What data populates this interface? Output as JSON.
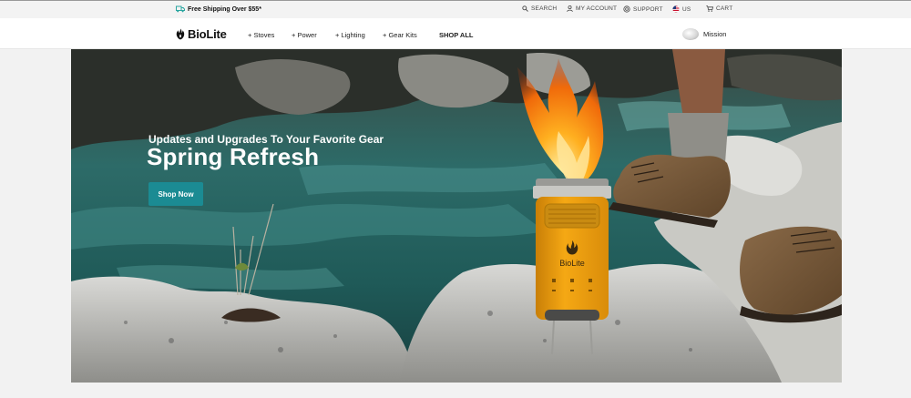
{
  "topbar": {
    "promo": "Free Shipping Over $55*",
    "search": "SEARCH",
    "account": "MY ACCOUNT",
    "support": "SUPPORT",
    "region": "US",
    "cart": "CART"
  },
  "nav": {
    "brand": "BioLite",
    "items": [
      {
        "label": "+ Stoves"
      },
      {
        "label": "+ Power"
      },
      {
        "label": "+ Lighting"
      },
      {
        "label": "+ Gear Kits"
      },
      {
        "label": "SHOP ALL"
      }
    ],
    "mission": "Mission"
  },
  "hero": {
    "subheading": "Updates and Upgrades To Your Favorite Gear",
    "headline": "Spring Refresh",
    "cta": "Shop Now",
    "stove_brand": "BioLite"
  },
  "icons": [
    "shipping-icon",
    "search-icon",
    "account-icon",
    "support-icon",
    "us-flag-icon",
    "cart-icon",
    "biolite-logo-icon"
  ],
  "colors": {
    "accent": "#1b8b93",
    "stove": "#f2a413",
    "topbar": "#f3f3f3"
  }
}
